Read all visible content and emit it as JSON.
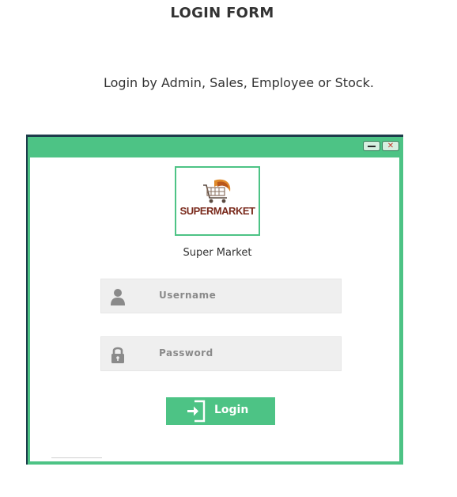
{
  "page": {
    "heading": "LOGIN FORM",
    "subheading": "Login by Admin, Sales, Employee or Stock."
  },
  "window": {
    "minimize_icon": "minimize-icon",
    "close_icon": "close-icon",
    "logo": {
      "text": "SUPERMARKET",
      "icon": "shopping-cart-icon"
    },
    "brand_label": "Super Market",
    "username": {
      "placeholder": "Username",
      "icon": "user-icon"
    },
    "password": {
      "placeholder": "Password",
      "icon": "lock-icon"
    },
    "login_button": {
      "label": "Login",
      "icon": "login-icon"
    }
  },
  "colors": {
    "accent": "#4dc385",
    "window_border": "#1d3b4a",
    "field_bg": "#efefef",
    "placeholder_text": "#8a8a8a",
    "logo_text": "#7a2a1c"
  }
}
